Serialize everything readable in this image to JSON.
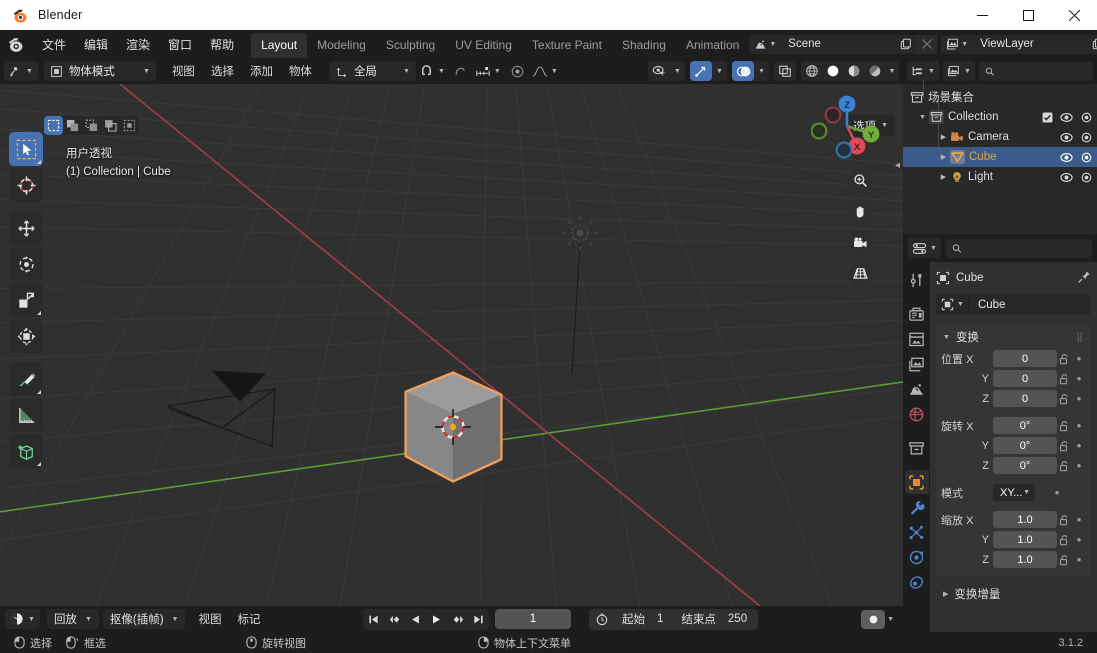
{
  "window": {
    "title": "Blender",
    "controls": {
      "minimize": "minimize",
      "maximize": "maximize",
      "close": "close"
    }
  },
  "topbar": {
    "menus": [
      "文件",
      "编辑",
      "渲染",
      "窗口",
      "帮助"
    ],
    "workspaces": [
      {
        "label": "Layout",
        "active": true
      },
      {
        "label": "Modeling",
        "active": false
      },
      {
        "label": "Sculpting",
        "active": false
      },
      {
        "label": "UV Editing",
        "active": false
      },
      {
        "label": "Texture Paint",
        "active": false
      },
      {
        "label": "Shading",
        "active": false
      },
      {
        "label": "Animation",
        "active": false
      }
    ],
    "scene": {
      "name": "Scene",
      "new_label": "new-scene",
      "delete_label": "delete-scene"
    },
    "view_layer": {
      "name": "ViewLayer",
      "new_label": "new-view-layer",
      "delete_label": "remove-view-layer"
    }
  },
  "viewport": {
    "header": {
      "editor_type": "editor-type",
      "mode": "物体模式",
      "menus": [
        "视图",
        "选择",
        "添加",
        "物体"
      ],
      "orientation": "全局",
      "snap_label": "snap",
      "proportional_label": "proportional-editing",
      "gizmo_label": "gizmos",
      "overlay_label": "overlays",
      "xray_label": "x-ray",
      "shading": [
        "wireframe",
        "solid",
        "material-preview",
        "rendered"
      ]
    },
    "select_modes": [
      "tweak",
      "box-select",
      "circle-select",
      "lasso-select"
    ],
    "options_label": "选项",
    "overlay_text_line1": "用户透视",
    "overlay_text_line2": "(1) Collection | Cube",
    "gizmo_axes": {
      "x": "X",
      "y": "Y",
      "z": "Z"
    },
    "tools": [
      {
        "name": "tweak-select-box",
        "active": true
      },
      {
        "name": "cursor",
        "active": false
      },
      {
        "name": "move",
        "active": false
      },
      {
        "name": "rotate",
        "active": false
      },
      {
        "name": "scale",
        "active": false
      },
      {
        "name": "transform",
        "active": false
      },
      {
        "name": "annotate",
        "active": false
      },
      {
        "name": "measure",
        "active": false
      },
      {
        "name": "add-cube",
        "active": false
      }
    ],
    "side_buttons": [
      "zoom-icon",
      "hand-icon",
      "camera-icon",
      "grid-icon"
    ],
    "object_name": "Cube",
    "outline_color": "#ED9E5C"
  },
  "timeline": {
    "editor_type": "editor-type",
    "menus": [
      "回放",
      "抠像(插帧)",
      "视图",
      "标记"
    ],
    "playback_label": "回放",
    "keying_label": "抠像(插帧)",
    "view_label": "视图",
    "marker_label": "标记",
    "record_label": "auto-keying",
    "transport": [
      "jump-to-start",
      "previous-keyframe",
      "play-reverse",
      "play",
      "next-keyframe",
      "jump-to-end"
    ],
    "current_frame": "1",
    "start_label": "起始",
    "start_value": "1",
    "end_label": "结束点",
    "end_value": "250"
  },
  "outliner": {
    "display_mode": "view-layer",
    "filter": "filter",
    "search_placeholder": "",
    "rows": [
      {
        "label": "场景集合",
        "depth": 0,
        "icon": "collection-icon",
        "expandable": false,
        "selected": false,
        "checkbox": false,
        "eye": false,
        "camera": false
      },
      {
        "label": "Collection",
        "depth": 1,
        "icon": "collection-icon",
        "expandable": true,
        "selected": false,
        "checkbox": true,
        "eye": true,
        "camera": true
      },
      {
        "label": "Camera",
        "depth": 2,
        "icon": "camera-data-icon",
        "expandable": true,
        "selected": false,
        "checkbox": false,
        "eye": true,
        "camera": true
      },
      {
        "label": "Cube",
        "depth": 2,
        "icon": "mesh-data-icon",
        "expandable": true,
        "selected": true,
        "checkbox": false,
        "eye": true,
        "camera": true
      },
      {
        "label": "Light",
        "depth": 2,
        "icon": "light-data-icon",
        "expandable": true,
        "selected": false,
        "checkbox": false,
        "eye": true,
        "camera": true
      }
    ]
  },
  "properties": {
    "editor_type": "properties-editor",
    "search_placeholder": "",
    "tabs": [
      {
        "name": "tool-tab",
        "active": false
      },
      {
        "name": "render-tab",
        "active": false
      },
      {
        "name": "output-tab",
        "active": false
      },
      {
        "name": "view-layer-tab",
        "active": false
      },
      {
        "name": "scene-tab",
        "active": false
      },
      {
        "name": "world-tab",
        "active": false
      },
      {
        "name": "collection-tab",
        "active": false
      },
      {
        "name": "object-tab",
        "active": true
      },
      {
        "name": "modifier-tab",
        "active": false
      },
      {
        "name": "particles-tab",
        "active": false
      },
      {
        "name": "physics-tab",
        "active": false
      },
      {
        "name": "constraints-tab",
        "active": false
      }
    ],
    "breadcrumb_object": "Cube",
    "pin_label": "pin-id",
    "name_value": "Cube",
    "transform_panel": {
      "title": "变换",
      "location_label": "位置",
      "rotation_label": "旋转",
      "mode_label": "模式",
      "scale_label": "缩放",
      "location": {
        "x": "0",
        "y": "0",
        "z": "0"
      },
      "rotation": {
        "x": "0°",
        "y": "0°",
        "z": "0°"
      },
      "rotation_mode": "XY...",
      "scale": {
        "x": "1.0",
        "y": "1.0",
        "z": "1.0"
      },
      "axis_x": "X",
      "axis_y": "Y",
      "axis_z": "Z"
    },
    "delta_transform_label": "变换增量"
  },
  "statusbar": {
    "items": [
      {
        "icon": "mouse-left-icon",
        "label": "选择"
      },
      {
        "icon": "mouse-drag-icon",
        "label": "框选"
      },
      {
        "icon": "mouse-middle-icon",
        "label": "旋转视图"
      },
      {
        "icon": "mouse-right-icon",
        "label": "物体上下文菜单"
      }
    ],
    "version": "3.1.2"
  }
}
